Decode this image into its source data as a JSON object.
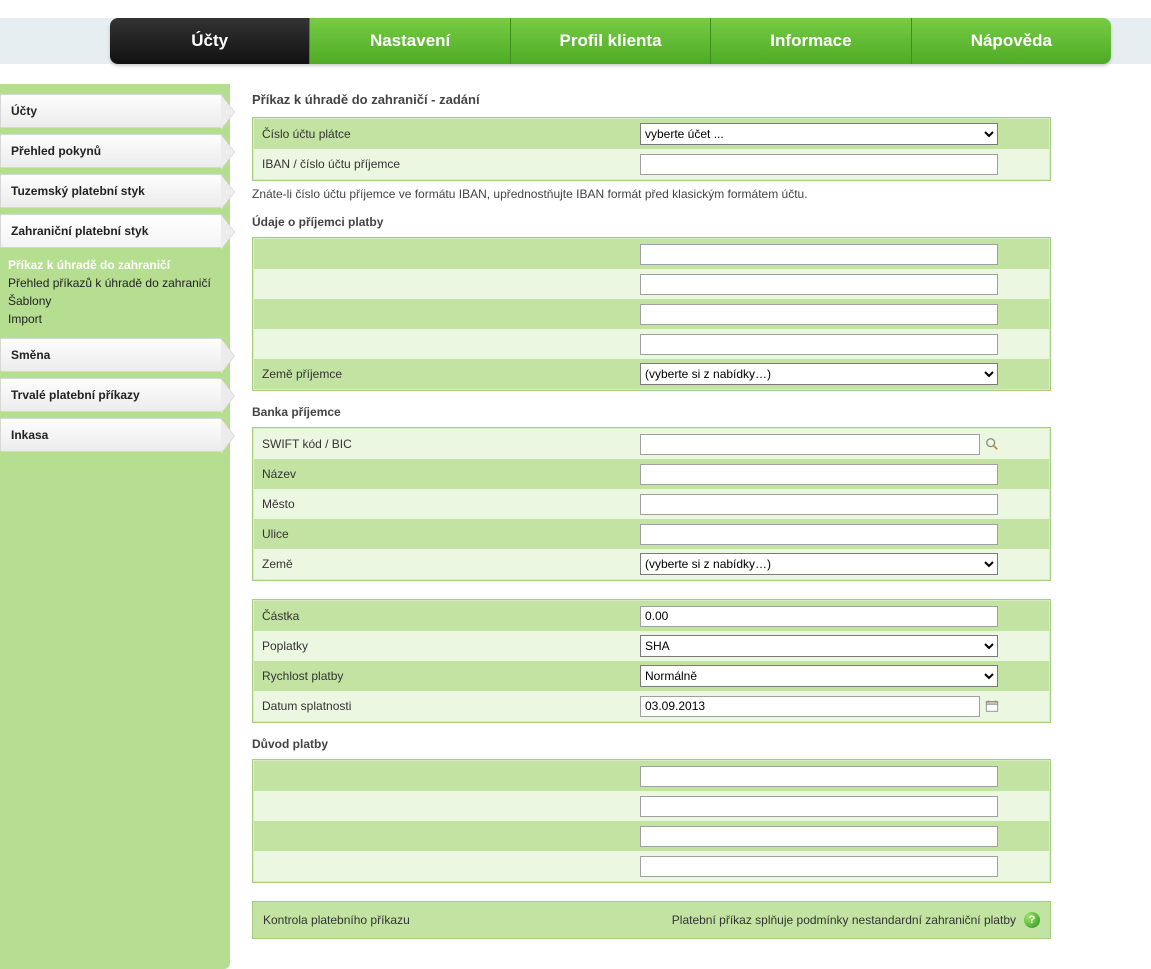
{
  "topnav": {
    "items": [
      {
        "label": "Účty",
        "active": true
      },
      {
        "label": "Nastavení",
        "active": false
      },
      {
        "label": "Profil klienta",
        "active": false
      },
      {
        "label": "Informace",
        "active": false
      },
      {
        "label": "Nápověda",
        "active": false
      }
    ]
  },
  "sidebar": {
    "items": [
      {
        "label": "Účty"
      },
      {
        "label": "Přehled pokynů"
      },
      {
        "label": "Tuzemský platební styk"
      },
      {
        "label": "Zahraniční platební styk",
        "expanded": true
      },
      {
        "label": "Směna"
      },
      {
        "label": "Trvalé platební příkazy"
      },
      {
        "label": "Inkasa"
      }
    ],
    "sub_foreign": [
      {
        "label": "Příkaz k úhradě do zahraničí",
        "active": true
      },
      {
        "label": "Přehled příkazů k úhradě do zahraničí",
        "active": false
      },
      {
        "label": "Šablony",
        "active": false
      },
      {
        "label": "Import",
        "active": false
      }
    ]
  },
  "page": {
    "title": "Příkaz k úhradě do zahraničí - zadání"
  },
  "account": {
    "payer_label": "Číslo účtu plátce",
    "payer_select_value": "vyberte účet ...",
    "iban_label": "IBAN / číslo účtu příjemce",
    "iban_value": "",
    "hint": "Znáte-li číslo účtu příjemce ve formátu IBAN, upřednostňujte IBAN formát před klasickým formátem účtu."
  },
  "recipient": {
    "section_title": "Údaje o příjemci platby",
    "lines": [
      "",
      "",
      "",
      ""
    ],
    "country_label": "Země příjemce",
    "country_value": "(vyberte si z nabídky…)"
  },
  "bank": {
    "section_title": "Banka příjemce",
    "swift_label": "SWIFT kód / BIC",
    "swift_value": "",
    "name_label": "Název",
    "name_value": "",
    "city_label": "Město",
    "city_value": "",
    "street_label": "Ulice",
    "street_value": "",
    "country_label": "Země",
    "country_value": "(vyberte si z nabídky…)"
  },
  "payment": {
    "amount_label": "Částka",
    "amount_value": "0.00",
    "fees_label": "Poplatky",
    "fees_value": "SHA",
    "speed_label": "Rychlost platby",
    "speed_value": "Normálně",
    "due_label": "Datum splatnosti",
    "due_value": "03.09.2013"
  },
  "reason": {
    "section_title": "Důvod platby",
    "lines": [
      "",
      "",
      "",
      ""
    ]
  },
  "check": {
    "label": "Kontrola platebního příkazu",
    "message": "Platební příkaz splňuje podmínky nestandardní zahraniční platby"
  }
}
